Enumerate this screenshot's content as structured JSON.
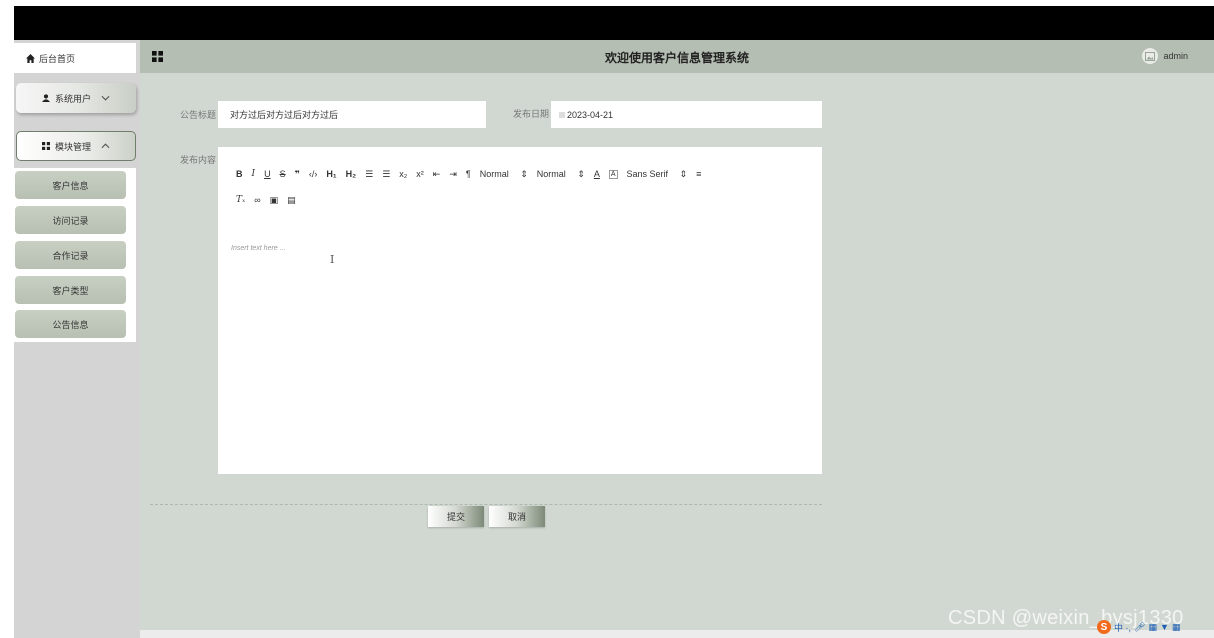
{
  "sidebar": {
    "home_label": "后台首页",
    "menus": [
      {
        "label": "系统用户",
        "expanded": false
      },
      {
        "label": "模块管理",
        "expanded": true
      }
    ],
    "sub_items": [
      "客户信息",
      "访问记录",
      "合作记录",
      "客户类型",
      "公告信息"
    ]
  },
  "header": {
    "title": "欢迎使用客户信息管理系统",
    "username": "admin"
  },
  "form": {
    "title_label": "公告标题",
    "title_value": "对方过后对方过后对方过后",
    "date_label": "发布日期",
    "date_value": "2023-04-21",
    "content_label": "发布内容",
    "editor_placeholder": "Insert text here ...",
    "toolbar": {
      "header_size": "Normal",
      "font_size": "Normal",
      "font_family": "Sans Serif"
    },
    "submit_label": "提交",
    "cancel_label": "取消"
  },
  "watermark": "CSDN @weixin_bysj1330",
  "ime_label": "中 ·, ",
  "colors": {
    "header_bg": "#b5beb2",
    "main_bg": "#d1d8d1",
    "sidebar_bg": "#d4d4d4",
    "accent_border": "#6f7e6a"
  }
}
